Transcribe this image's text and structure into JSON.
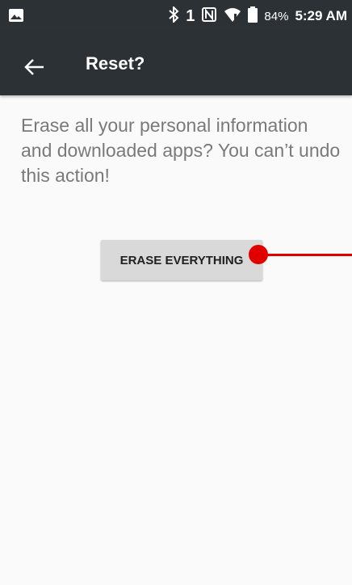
{
  "status_bar": {
    "icons": [
      "gallery-icon",
      "bluetooth-icon",
      "sim-1-icon",
      "nfc-icon",
      "wifi-icon",
      "battery-icon"
    ],
    "sim_label": "1",
    "battery_percent": "84%",
    "time": "5:29 AM"
  },
  "app_bar": {
    "back_icon": "arrow-left-icon",
    "title": "Reset?"
  },
  "content": {
    "message": "Erase all your personal information and downloaded apps? You can’t undo this action!",
    "erase_button_label": "ERASE EVERYTHING"
  },
  "colors": {
    "bar_background": "#2b3134",
    "page_background": "#fafafa",
    "message_text": "#7a7a7a",
    "button_background": "#d9d9d9",
    "touch_indicator": "#e00000"
  }
}
